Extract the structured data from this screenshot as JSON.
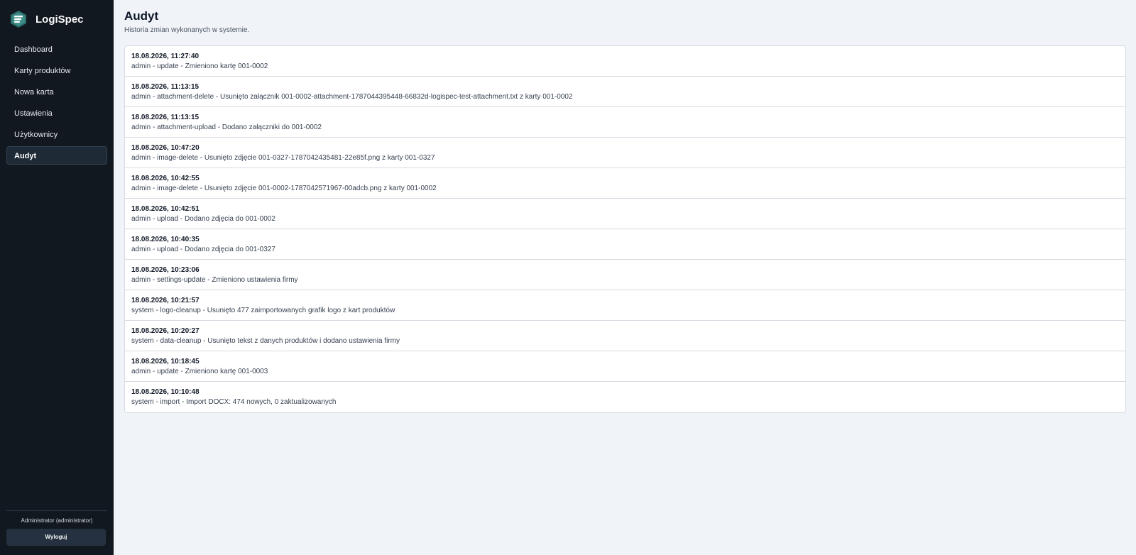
{
  "app": {
    "name": "LogiSpec"
  },
  "nav": [
    {
      "label": "Dashboard",
      "active": false
    },
    {
      "label": "Karty produktów",
      "active": false
    },
    {
      "label": "Nowa karta",
      "active": false
    },
    {
      "label": "Ustawienia",
      "active": false
    },
    {
      "label": "Użytkownicy",
      "active": false
    },
    {
      "label": "Audyt",
      "active": true
    }
  ],
  "footer": {
    "user": "Administrator (administrator)",
    "logout_label": "Wyloguj"
  },
  "page": {
    "title": "Audyt",
    "subtitle": "Historia zmian wykonanych w systemie."
  },
  "entries": [
    {
      "time": "18.08.2026, 11:27:40",
      "desc": "admin - update - Zmieniono kartę 001-0002"
    },
    {
      "time": "18.08.2026, 11:13:15",
      "desc": "admin - attachment-delete - Usunięto załącznik 001-0002-attachment-1787044395448-66832d-logispec-test-attachment.txt z karty 001-0002"
    },
    {
      "time": "18.08.2026, 11:13:15",
      "desc": "admin - attachment-upload - Dodano załączniki do 001-0002"
    },
    {
      "time": "18.08.2026, 10:47:20",
      "desc": "admin - image-delete - Usunięto zdjęcie 001-0327-1787042435481-22e85f.png z karty 001-0327"
    },
    {
      "time": "18.08.2026, 10:42:55",
      "desc": "admin - image-delete - Usunięto zdjęcie 001-0002-1787042571967-00adcb.png z karty 001-0002"
    },
    {
      "time": "18.08.2026, 10:42:51",
      "desc": "admin - upload - Dodano zdjęcia do 001-0002"
    },
    {
      "time": "18.08.2026, 10:40:35",
      "desc": "admin - upload - Dodano zdjęcia do 001-0327"
    },
    {
      "time": "18.08.2026, 10:23:06",
      "desc": "admin - settings-update - Zmieniono ustawienia firmy"
    },
    {
      "time": "18.08.2026, 10:21:57",
      "desc": "system - logo-cleanup - Usunięto 477 zaimportowanych grafik logo z kart produktów"
    },
    {
      "time": "18.08.2026, 10:20:27",
      "desc": "system - data-cleanup - Usunięto tekst z danych produktów i dodano ustawienia firmy"
    },
    {
      "time": "18.08.2026, 10:18:45",
      "desc": "admin - update - Zmieniono kartę 001-0003"
    },
    {
      "time": "18.08.2026, 10:10:48",
      "desc": "system - import - Import DOCX: 474 nowych, 0 zaktualizowanych"
    }
  ]
}
